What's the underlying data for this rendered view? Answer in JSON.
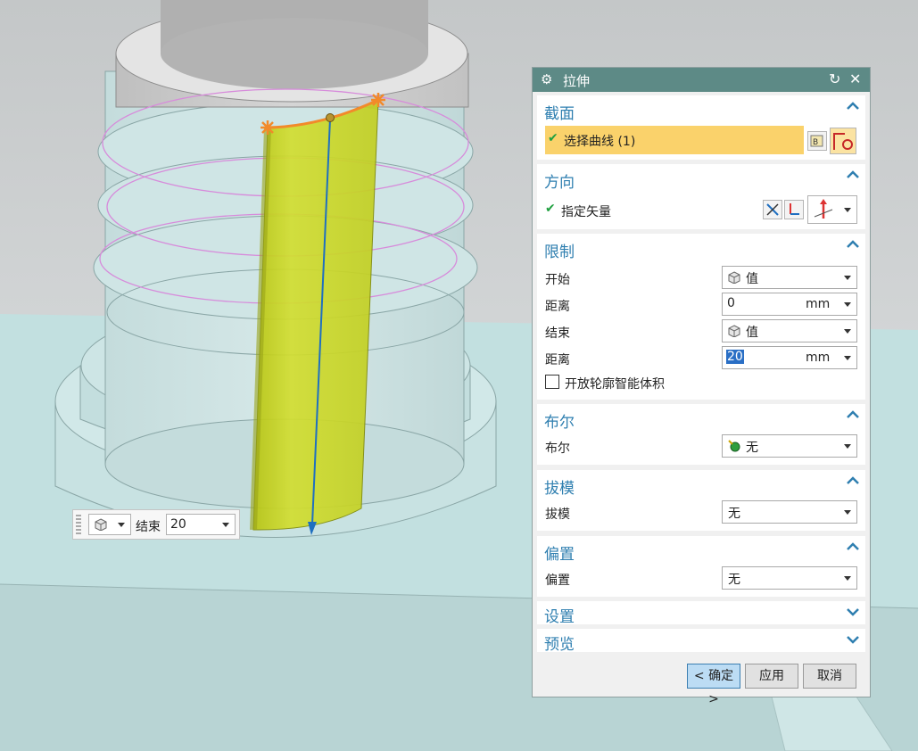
{
  "dialog": {
    "title": "拉伸",
    "sections": {
      "section": {
        "header": "截面",
        "select_curve": "选择曲线 (1)"
      },
      "direction": {
        "header": "方向",
        "specify_vector": "指定矢量"
      },
      "limits": {
        "header": "限制",
        "start_label": "开始",
        "start_value": "值",
        "start_distance_label": "距离",
        "start_distance": "0",
        "start_unit": "mm",
        "end_label": "结束",
        "end_value": "值",
        "end_distance_label": "距离",
        "end_distance": "20",
        "end_unit": "mm",
        "open_profile_label": "开放轮廓智能体积"
      },
      "boolean": {
        "header": "布尔",
        "label": "布尔",
        "value": "无"
      },
      "draft": {
        "header": "拔模",
        "label": "拔模",
        "value": "无"
      },
      "offset": {
        "header": "偏置",
        "label": "偏置",
        "value": "无"
      },
      "settings": {
        "header": "设置"
      },
      "preview": {
        "header": "预览"
      }
    },
    "buttons": {
      "ok": "< 确定 >",
      "apply": "应用",
      "cancel": "取消"
    }
  },
  "floating_toolbar": {
    "label": "结束",
    "value": "20"
  },
  "colors": {
    "titlebar": "#5d8a86",
    "accent": "#2f7fb0",
    "highlight": "#fad26b",
    "surface": "#cfe02a"
  },
  "icons": [
    "settings-gear-icon",
    "reset-icon",
    "close-icon",
    "chevron-up-icon",
    "chevron-down-icon",
    "check-icon",
    "curve-rule-icon",
    "sketch-section-icon",
    "reverse-direction-icon",
    "vector-dialog-icon",
    "vector-constructor-icon",
    "cube-value-icon",
    "boolean-none-icon"
  ]
}
